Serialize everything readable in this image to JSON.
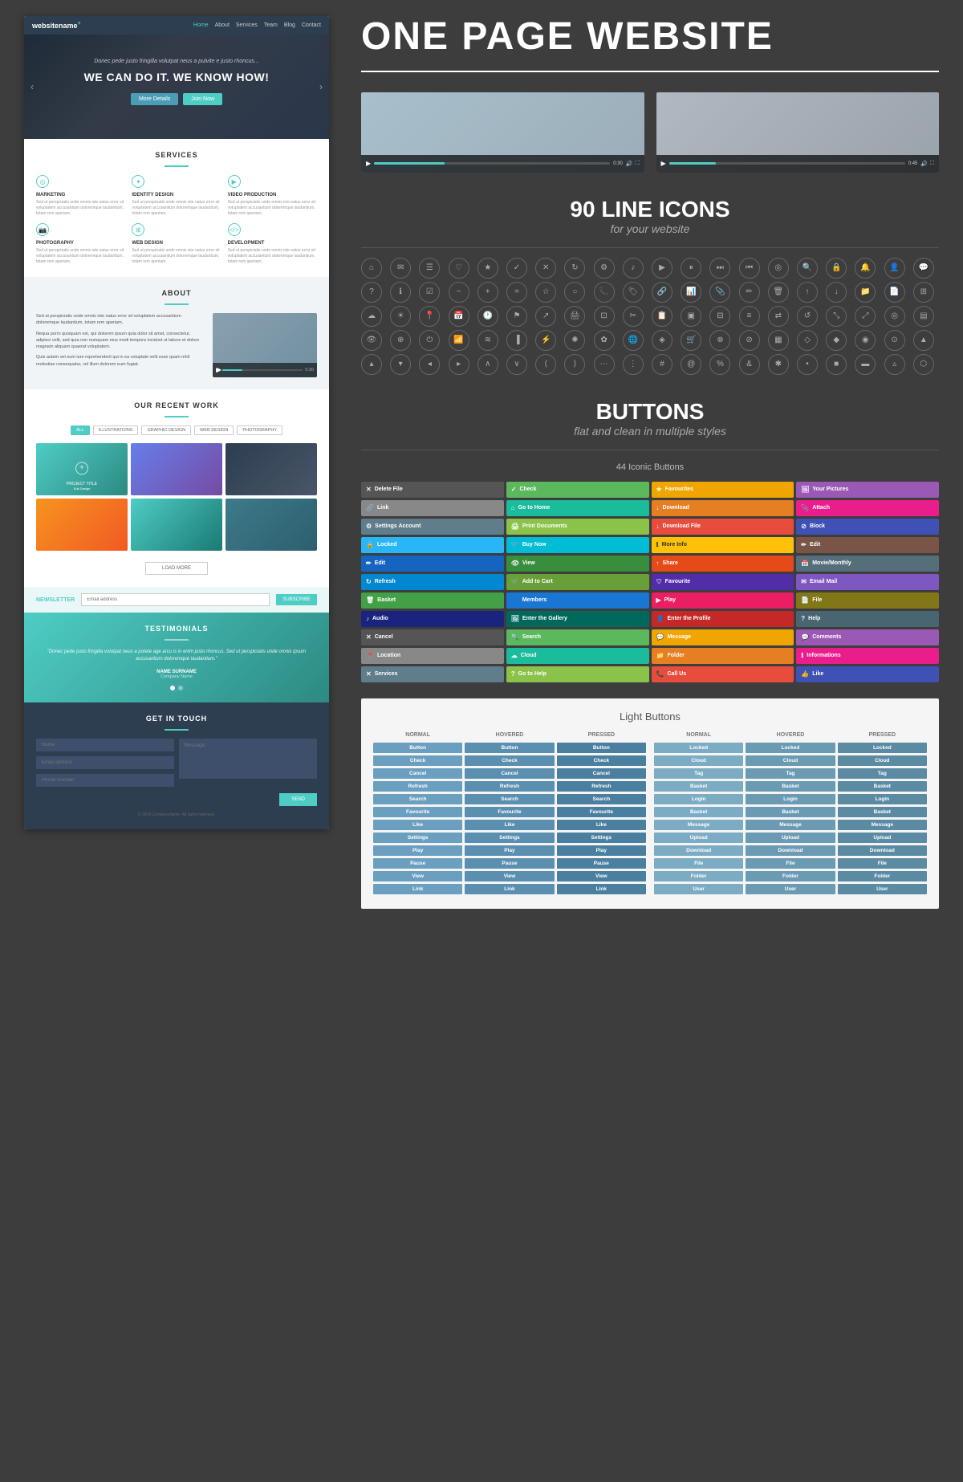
{
  "left": {
    "nav": {
      "brand": "websitename",
      "brand_sup": "+",
      "links": [
        "Home",
        "About",
        "Services",
        "Team",
        "Blog",
        "Contact"
      ]
    },
    "hero": {
      "sub": "Donec pede justo fringilla volutpat neus a pulvite e justo rhoncus...",
      "headline": "WE CAN DO IT. WE KNOW HOW!",
      "btn1": "More Details",
      "btn2": "Join Now"
    },
    "services": {
      "title": "SERVICES",
      "items": [
        {
          "name": "MARKETING",
          "desc": "Sed ut perspiciatis unde omnis iste natus error sit voluptatem accusantium doloremque laudantium, totam rem aperiam."
        },
        {
          "name": "IDENTITY DESIGN",
          "desc": "Sed ut perspiciatis unde omnis iste natus error sit voluptatem accusantium doloremque laudantium, totam rem aperiam."
        },
        {
          "name": "VIDEO PRODUCTION",
          "desc": "Sed ut perspiciatis unde omnis iste natus error sit voluptatem accusantium doloremque laudantium, totam rem aperiam."
        },
        {
          "name": "PHOTOGRAPHY",
          "desc": "Sed ut perspiciatis unde omnis iste natus error sit voluptatem accusantium doloremque laudantium, totam rem aperiam."
        },
        {
          "name": "WEB DESIGN",
          "desc": "Sed ut perspiciatis unde omnis iste natus error sit voluptatem accusantium doloremque laudantium, totam rem aperiam."
        },
        {
          "name": "DEVELOPMENT",
          "desc": "Sed ut perspiciatis unde omnis iste natus error sit voluptatem accusantium doloremque laudantium, totam rem aperiam."
        }
      ]
    },
    "about": {
      "title": "ABOUT",
      "text1": "Sed ut perspiciatis unde omnis iste natus error sit voluplatem accusantium doloremque laudantium, totam rem aperiam.",
      "text2": "Nequa porro quisquam est, qui dolorem ipsum quia dolor sit amet, consectetur, adipisci velit, sed quia non numquam eius modi tempora incidunt ut labore et dolore magnam aliquam quaerat voluptatem.",
      "text3": "Quis autem vel eum iure reprehenderit qui in ea voluptate velit esse quam nihil molestiae consequatur, vel illum dolorem eum fugiat."
    },
    "recentWork": {
      "title": "OUR RECENT WORK",
      "tabs": [
        "ALL",
        "ILLUSTRATIONS",
        "GRAPHIC DESIGN",
        "WEB DESIGN",
        "PHOTOGRAPHY"
      ],
      "items": [
        {
          "label": "PROJECT TITLE\nSub Design",
          "style": 1
        },
        {
          "style": 2
        },
        {
          "style": 3
        },
        {
          "style": 4
        },
        {
          "style": 5
        },
        {
          "style": 6
        }
      ],
      "load_more": "LOAD MORE"
    },
    "newsletter": {
      "label": "NEWSLETTER",
      "placeholder": "Email address",
      "btn": "SUBSCRIBE"
    },
    "testimonials": {
      "title": "TESTIMONIALS",
      "quote": "\"Donec pede justo fringilla volutpat neus a potete age arcu is in enim justo rhoncus. Sed ut perspiciatis unde omnis ipsum accusantium doloremque laudantium.\"",
      "name": "NAME SURNAME",
      "company": "Company Name"
    },
    "contact": {
      "title": "GET IN TOUCH",
      "name_placeholder": "Name",
      "email_placeholder": "Email address",
      "phone_placeholder": "Phone Number",
      "message_placeholder": "Message",
      "send_btn": "SEND",
      "footer": "© 2014 CompanyName. All rights reserved."
    }
  },
  "right": {
    "title": "ONE PAGE WEBSITE",
    "icons_section": {
      "title": "90 LINE ICONS",
      "subtitle": "for your website",
      "icons": [
        "⌂",
        "✉",
        "☰",
        "♡",
        "★",
        "✓",
        "✕",
        "↻",
        "⚙",
        "♪",
        "▶",
        "⏸",
        "⏭",
        "⏮",
        "📷",
        "🔍",
        "🔒",
        "🔔",
        "👤",
        "💬",
        "🗂",
        "📎",
        "✏",
        "🗑",
        "📤",
        "📥",
        "🔗",
        "📊",
        "📋",
        "🗃",
        "⊕",
        "⊖",
        "⊗",
        "⊘",
        "◉",
        "○",
        "⬜",
        "⬛",
        "▲",
        "▼",
        "◀",
        "▶",
        "⟨",
        "⟩",
        "⋯",
        "⁝",
        "※",
        "◈",
        "◇",
        "◆",
        "⊞",
        "⊟",
        "⊠",
        "⊡",
        "▣",
        "▤",
        "▥",
        "▦",
        "▧",
        "▨",
        "▩",
        "▪",
        "▫",
        "▬",
        "▭",
        "▮",
        "▯",
        "▰",
        "▱",
        "▲",
        "▴",
        "▵",
        "▶",
        "▷",
        "▸",
        "▹",
        "►",
        "▻",
        "▼",
        "▾",
        "▿",
        "◀",
        "◁",
        "◂",
        "◃",
        "◄",
        "◅",
        "◆",
        "◇",
        "◈",
        "◉",
        "◊",
        "○",
        "◌",
        "◍"
      ]
    },
    "buttons_section": {
      "title": "BUTTONS",
      "subtitle": "flat and clean in multiple styles",
      "iconic_title": "44 Iconic Buttons",
      "iconic_buttons": [
        {
          "label": "Delete File",
          "icon": "✕",
          "color": "dark"
        },
        {
          "label": "Check",
          "icon": "✓",
          "color": "green"
        },
        {
          "label": "Favourites",
          "icon": "★",
          "color": "yellow"
        },
        {
          "label": "Your Pictures",
          "icon": "🖼",
          "color": "purple"
        },
        {
          "label": "Link",
          "icon": "🔗",
          "color": "gray"
        },
        {
          "label": "Go to Home",
          "icon": "⌂",
          "color": "teal"
        },
        {
          "label": "Download",
          "icon": "↓",
          "color": "orange"
        },
        {
          "label": "Attach",
          "icon": "📎",
          "color": "pink"
        },
        {
          "label": "Settings Account",
          "icon": "⚙",
          "color": "slate"
        },
        {
          "label": "Print Documents",
          "icon": "🖨",
          "color": "lime"
        },
        {
          "label": "Download File",
          "icon": "↓",
          "color": "red"
        },
        {
          "label": "Block",
          "icon": "⊘",
          "color": "indigo"
        },
        {
          "label": "Locked",
          "icon": "🔒",
          "color": "blue-light"
        },
        {
          "label": "Buy Now",
          "icon": "🛒",
          "color": "cyan"
        },
        {
          "label": "More Info",
          "icon": "ℹ",
          "color": "amber"
        },
        {
          "label": "Edit",
          "icon": "✏",
          "color": "brown"
        },
        {
          "label": "Edit",
          "icon": "✏",
          "color": "blue-dark"
        },
        {
          "label": "View",
          "icon": "👁",
          "color": "green-dark"
        },
        {
          "label": "Share",
          "icon": "↑",
          "color": "deep-orange"
        },
        {
          "label": "Movie/Monthly",
          "icon": "📅",
          "color": "blue-grey"
        },
        {
          "label": "Refresh",
          "icon": "↻",
          "color": "light-blue"
        },
        {
          "label": "Add to Cart",
          "icon": "🛒",
          "color": "light-green"
        },
        {
          "label": "Favourite",
          "icon": "♡",
          "color": "deep-purple"
        },
        {
          "label": "Email Mail",
          "icon": "✉",
          "color": "light-purple"
        },
        {
          "label": "Basket",
          "icon": "🗑",
          "color": "medium-green"
        },
        {
          "label": "Members",
          "icon": "👤",
          "color": "medium-blue"
        },
        {
          "label": "Play",
          "icon": "▶",
          "color": "rose"
        },
        {
          "label": "File",
          "icon": "📄",
          "color": "olive"
        },
        {
          "label": "Audio",
          "icon": "♪",
          "color": "navy"
        },
        {
          "label": "Enter the Gallery",
          "icon": "🖼",
          "color": "teal-dark"
        },
        {
          "label": "Enter the Profile",
          "icon": "👤",
          "color": "red-dark"
        },
        {
          "label": "Help",
          "icon": "?",
          "color": "steel"
        },
        {
          "label": "Cancel",
          "icon": "✕",
          "color": "dark"
        },
        {
          "label": "Search",
          "icon": "🔍",
          "color": "green"
        },
        {
          "label": "Message",
          "icon": "💬",
          "color": "yellow"
        },
        {
          "label": "Comments",
          "icon": "💬",
          "color": "purple"
        },
        {
          "label": "Location",
          "icon": "📍",
          "color": "gray"
        },
        {
          "label": "Cloud",
          "icon": "☁",
          "color": "teal"
        },
        {
          "label": "Folder",
          "icon": "📁",
          "color": "orange"
        },
        {
          "label": "Informations",
          "icon": "ℹ",
          "color": "pink"
        },
        {
          "label": "Services",
          "icon": "✕",
          "color": "slate"
        },
        {
          "label": "Go to Help",
          "icon": "?",
          "color": "lime"
        },
        {
          "label": "Call Us",
          "icon": "📞",
          "color": "red"
        },
        {
          "label": "Like",
          "icon": "👍",
          "color": "indigo"
        }
      ],
      "light_buttons_title": "Light Buttons",
      "light_buttons_cols": [
        "NORMAL",
        "HOVERED",
        "PRESSED"
      ],
      "light_button_labels": [
        "Button",
        "Check",
        "Cancel",
        "Refresh",
        "Search",
        "Favourite",
        "Like",
        "Settings",
        "Play",
        "Pause",
        "View",
        "Link"
      ],
      "light_button_labels2": [
        "Locked",
        "Cloud",
        "Tag",
        "Basket",
        "Login",
        "Basket",
        "Message",
        "Upload",
        "Download",
        "File",
        "Folder",
        "User"
      ]
    }
  }
}
